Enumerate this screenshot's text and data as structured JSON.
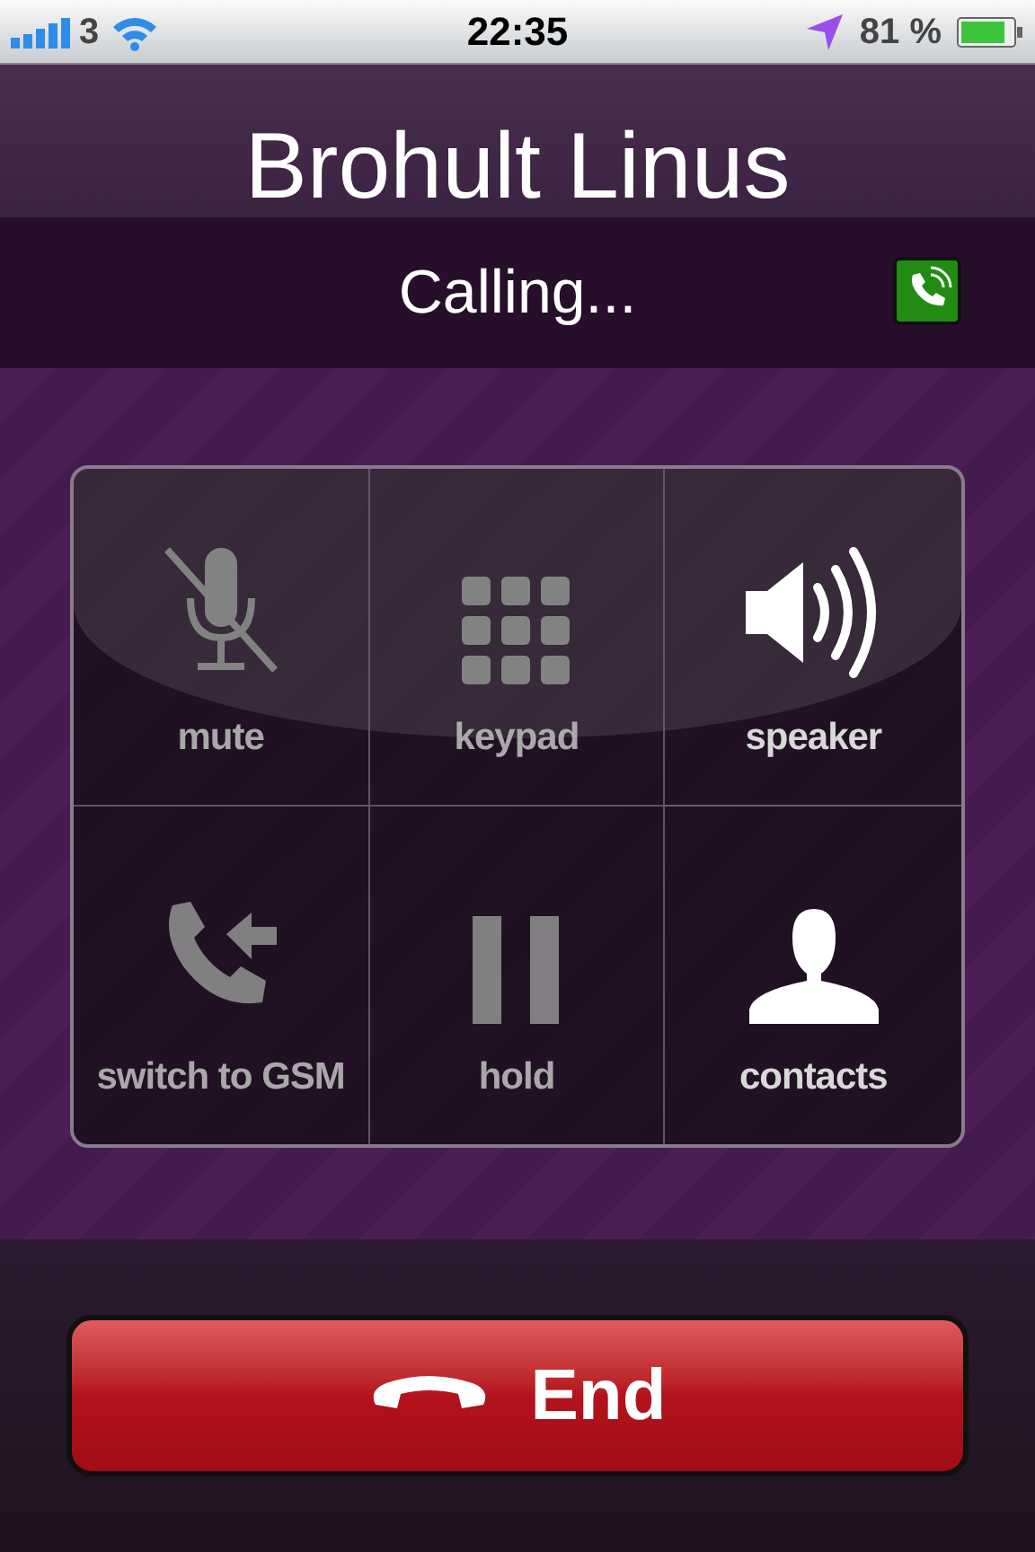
{
  "status_bar": {
    "carrier": "3",
    "time": "22:35",
    "battery": "81 %"
  },
  "call": {
    "name": "Brohult Linus",
    "status": "Calling..."
  },
  "controls": [
    {
      "label": "mute",
      "kind": "mute",
      "disabled": true
    },
    {
      "label": "keypad",
      "kind": "keypad",
      "disabled": true
    },
    {
      "label": "speaker",
      "kind": "speaker",
      "disabled": false
    },
    {
      "label": "switch to GSM",
      "kind": "switch",
      "disabled": true
    },
    {
      "label": "hold",
      "kind": "hold",
      "disabled": true
    },
    {
      "label": "contacts",
      "kind": "contacts",
      "disabled": false
    }
  ],
  "end_button": {
    "label": "End"
  }
}
